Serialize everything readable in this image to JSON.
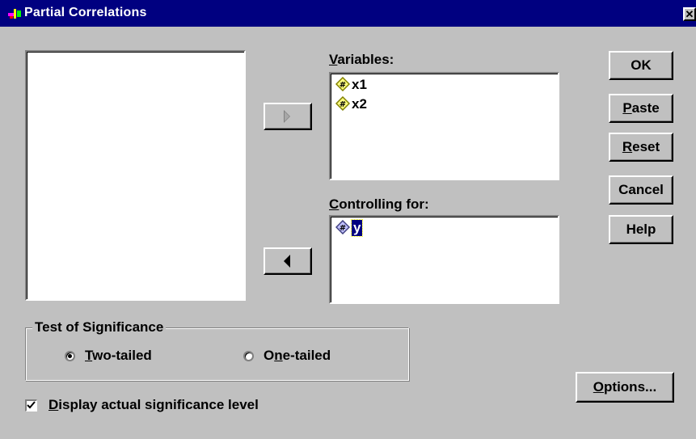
{
  "window": {
    "title": "Partial Correlations",
    "close_glyph": "✕"
  },
  "variables_label": {
    "before": "",
    "mnemonic": "V",
    "after": "ariables:"
  },
  "variables_list": [
    {
      "name": "x1",
      "icon": "scale-variable-icon"
    },
    {
      "name": "x2",
      "icon": "scale-variable-icon"
    }
  ],
  "controlling_label": {
    "before": "",
    "mnemonic": "C",
    "after": "ontrolling for:"
  },
  "controlling_list": [
    {
      "name": "y",
      "icon": "scale-variable-icon",
      "selected": true
    }
  ],
  "buttons": {
    "ok": "OK",
    "paste": {
      "mnemonic": "P",
      "after": "aste"
    },
    "reset": {
      "mnemonic": "R",
      "after": "eset"
    },
    "cancel": "Cancel",
    "help": "Help",
    "options": {
      "mnemonic": "O",
      "after": "ptions..."
    }
  },
  "significance": {
    "legend": "Test of Significance",
    "two_tailed": {
      "mnemonic": "T",
      "after": "wo-tailed",
      "selected": true
    },
    "one_tailed": {
      "before": "O",
      "mnemonic": "n",
      "after": "e-tailed",
      "selected": false
    }
  },
  "display_sig": {
    "mnemonic": "D",
    "after": "isplay actual significance level",
    "checked": true
  },
  "colors": {
    "titlebar": "#000080",
    "face": "#c0c0c0",
    "selection": "#000080"
  }
}
